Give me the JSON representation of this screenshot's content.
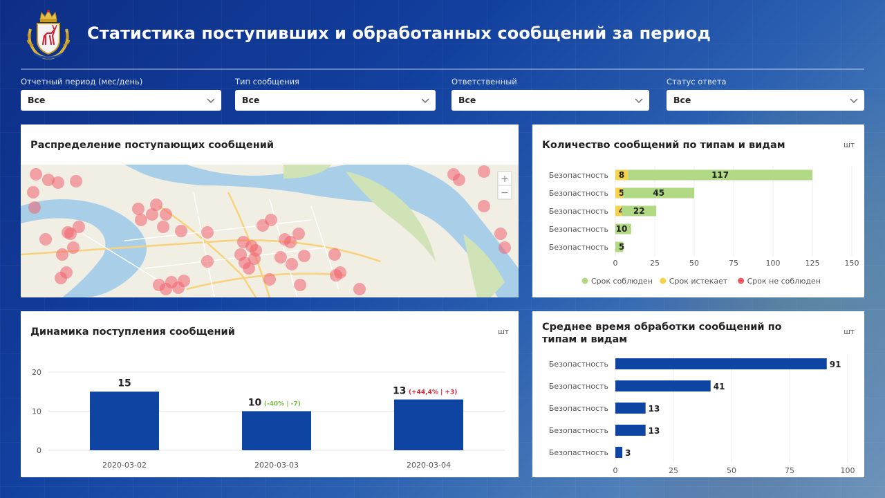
{
  "header": {
    "title": "Статистика поступивших и обработанных сообщений за период",
    "logo_icon": "nizhny-novgorod-coat-of-arms-icon"
  },
  "filters": [
    {
      "label": "Отчетный период (мес/день)",
      "value": "Все"
    },
    {
      "label": "Тип сообщения",
      "value": "Все"
    },
    {
      "label": "Ответственный",
      "value": "Все"
    },
    {
      "label": "Статус ответа",
      "value": "Все"
    }
  ],
  "map_card": {
    "title": "Распределение поступающих сообщений",
    "zoom_in_label": "+",
    "zoom_out_label": "−"
  },
  "types_card": {
    "title": "Количество сообщений по типам и видам",
    "unit": "шт",
    "chart_data": {
      "type": "bar",
      "orientation": "horizontal",
      "stacked": true,
      "categories": [
        "Безопастность",
        "Безопастность",
        "Безопастность",
        "Безопастность",
        "Безопастность"
      ],
      "series": [
        {
          "name": "Срок соблюден",
          "color": "#b1d882",
          "values": [
            117,
            45,
            22,
            10,
            5
          ]
        },
        {
          "name": "Срок истекает",
          "color": "#f5d24c",
          "values": [
            8,
            5,
            4,
            0,
            0
          ]
        },
        {
          "name": "Срок не соблюден",
          "color": "#f05a64",
          "values": [
            0,
            0,
            0,
            0,
            0
          ]
        }
      ],
      "xlim": [
        0,
        150
      ],
      "xticks": [
        0,
        25,
        50,
        75,
        100,
        125,
        150
      ],
      "legend": "bottom",
      "grid": true
    }
  },
  "dynamics_card": {
    "title": "Динамика поступления сообщений",
    "unit": "шт",
    "chart_data": {
      "type": "bar",
      "categories": [
        "2020-03-02",
        "2020-03-03",
        "2020-03-04"
      ],
      "values": [
        15,
        10,
        13
      ],
      "ylim": [
        0,
        20
      ],
      "yticks": [
        0,
        10,
        20
      ],
      "annotations": [
        "",
        "(-40% | -7)",
        "(+44,4%  |  +3)"
      ],
      "annotation_colors": [
        "",
        "#7cc24a",
        "#d0283a"
      ],
      "color": "#0e45a3",
      "grid": true
    }
  },
  "avg_time_card": {
    "title": "Среднее время обработки сообщений по типам и видам",
    "unit": "шт",
    "chart_data": {
      "type": "bar",
      "orientation": "horizontal",
      "categories": [
        "Безопастность",
        "Безопастность",
        "Безопастность",
        "Безопастность",
        "Безопастность"
      ],
      "values": [
        91,
        41,
        13,
        13,
        3
      ],
      "xlim": [
        0,
        100
      ],
      "xticks": [
        0,
        25,
        50,
        75,
        100
      ],
      "color": "#0e45a3",
      "grid": true
    }
  }
}
